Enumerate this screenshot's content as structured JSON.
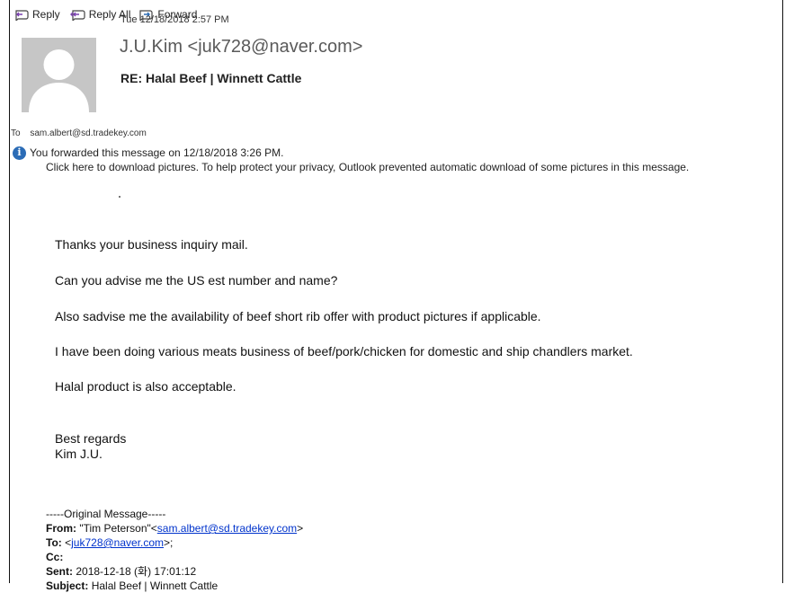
{
  "toolbar": {
    "reply_label": "Reply",
    "reply_all_label": "Reply All",
    "forward_label": "Forward"
  },
  "header": {
    "date": "Tue 12/18/2018 2:57 PM",
    "sender": "J.U.Kim <juk728@naver.com>",
    "subject": "RE: Halal Beef | Winnett Cattle",
    "to_label": "To",
    "to_address": "sam.albert@sd.tradekey.com"
  },
  "info": {
    "forwarded_text": "You forwarded this message on 12/18/2018 3:26 PM.",
    "download_text": "Click here to download pictures. To help protect your privacy, Outlook prevented automatic download of some pictures in this message."
  },
  "body": {
    "line1": "Thanks your business inquiry mail.",
    "line2": "Can you advise me the US est number and name?",
    "line3": "Also sadvise me the availability of beef short rib offer with product pictures if applicable.",
    "line4": "I have been doing various meats business of beef/pork/chicken for domestic and ship chandlers market.",
    "line5": "Halal product is also acceptable.",
    "closing": "Best regards",
    "signature": "Kim J.U."
  },
  "original": {
    "header": "-----Original Message-----",
    "from_label": "From:",
    "from_name": "\"Tim Peterson\"<",
    "from_email": "sam.albert@sd.tradekey.com",
    "from_end": ">",
    "to_label": "To:",
    "to_open": "<",
    "to_email": "juk728@naver.com",
    "to_end": ">;",
    "cc_label": "Cc:",
    "sent_label": "Sent:",
    "sent_value": "2018-12-18 (화) 17:01:12",
    "subject_label": "Subject:",
    "subject_value": "Halal Beef | Winnett Cattle"
  },
  "colors": {
    "link": "#0033cc",
    "info_icon": "#2b6cb6",
    "avatar_bg": "#c6c6c6"
  },
  "icons": {
    "reply": "reply-icon",
    "reply_all": "reply-all-icon",
    "forward": "forward-icon",
    "info": "info-icon",
    "avatar": "avatar-placeholder"
  }
}
